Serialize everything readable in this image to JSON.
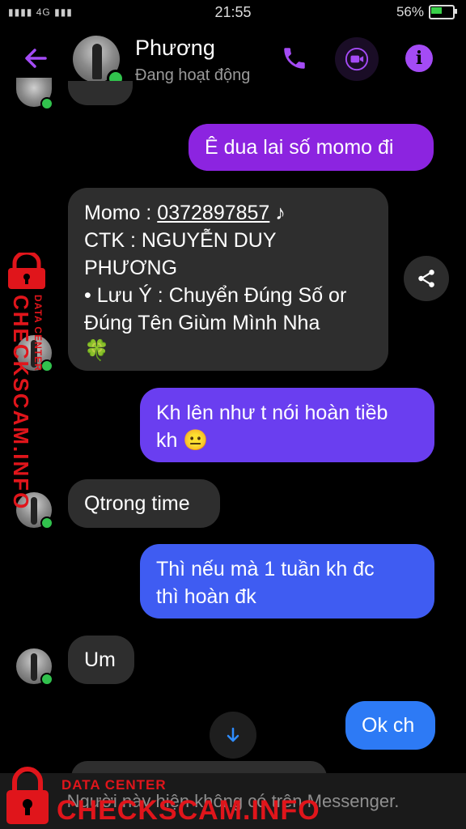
{
  "status_bar": {
    "signal": "4G",
    "time": "21:55",
    "battery": "56%",
    "battery_level": 0.56
  },
  "header": {
    "contact_name": "Phương",
    "contact_status": "Đang hoạt động",
    "icons": {
      "back": "arrow-left-icon",
      "call": "phone-icon",
      "video": "video-camera-icon",
      "info": "info-icon"
    }
  },
  "messages": [
    {
      "from": "me",
      "text": "Ê dua lai số momo đi"
    },
    {
      "from": "them",
      "lines": [
        "Momo : ",
        "0372897857",
        " ♪",
        "CTK : NGUYỄN DUY",
        "PHƯƠNG",
        "• Lưu Ý : Chuyển Đúng Số or",
        "Đúng Tên Giùm Mình Nha",
        "🍀"
      ]
    },
    {
      "from": "me",
      "lines": [
        "Kh lên như t nói hoàn tiềb",
        "kh 😐"
      ]
    },
    {
      "from": "them",
      "text": "Qtrong time"
    },
    {
      "from": "me",
      "lines": [
        "Thì nếu mà 1 tuần kh đc",
        "thì hoàn đk"
      ]
    },
    {
      "from": "them",
      "text": "Um"
    },
    {
      "from": "me",
      "text": "Ok ch"
    }
  ],
  "footer": {
    "notice": "Người này hiện không có trên Messenger."
  },
  "watermark": {
    "small": "DATA CENTER",
    "big": "CHECKSCAM.INFO"
  },
  "colors": {
    "accent": "#a44bf5",
    "bubble_in": "#2e2e2e",
    "online": "#31c24d",
    "watermark": "#e0151b"
  }
}
